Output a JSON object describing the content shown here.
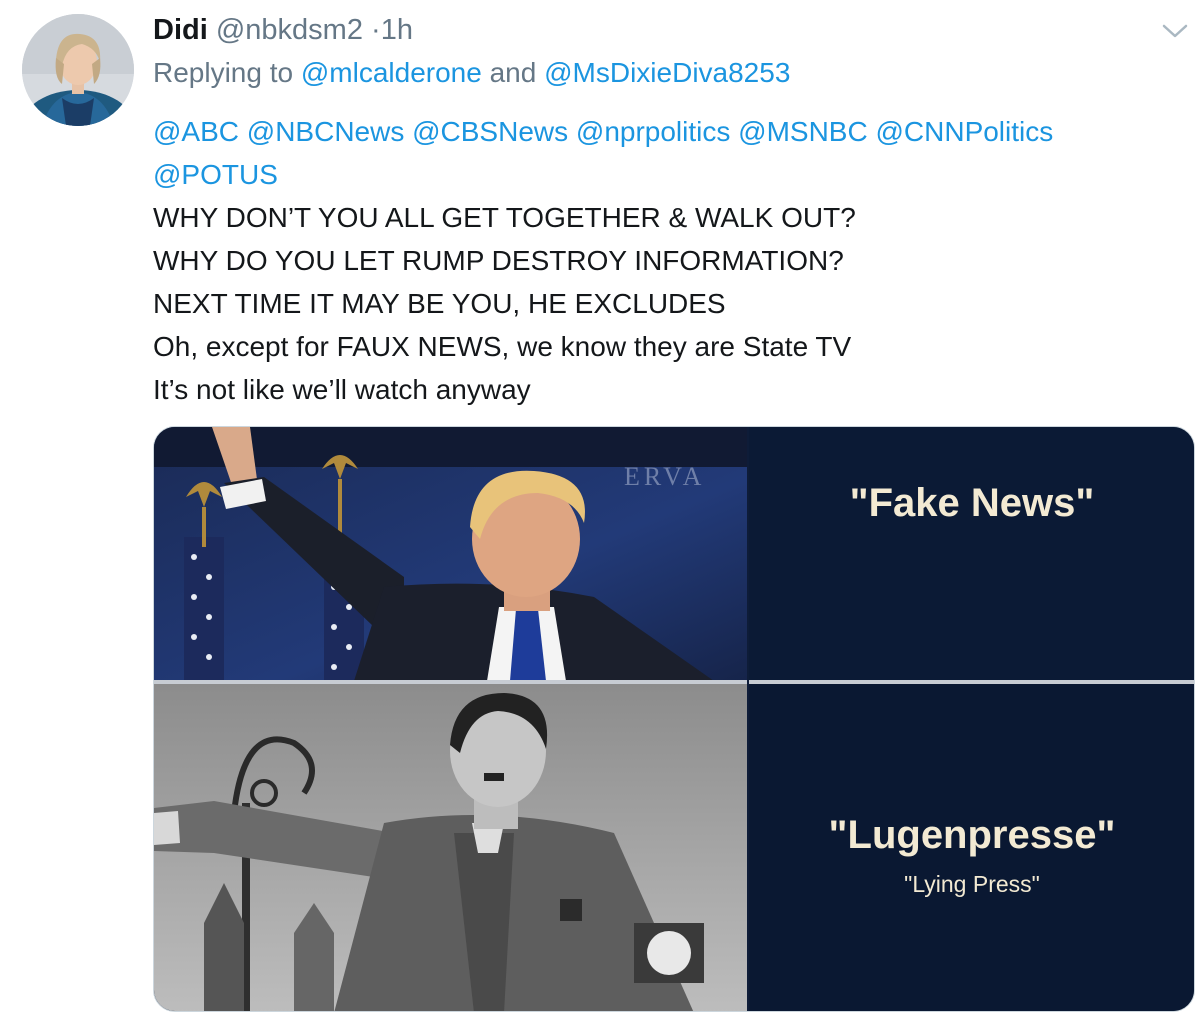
{
  "tweet": {
    "display_name": "Didi",
    "handle": "@nbkdsm2",
    "separator": "·",
    "time": "1h",
    "replying_prefix": "Replying to",
    "reply_user_1": "@mlcalderone",
    "reply_and": "and",
    "reply_user_2": "@MsDixieDiva8253",
    "mentions_line_1": "@ABC @NBCNews @CBSNews @nprpolitics @MSNBC @CNNPolitics",
    "mentions_line_2": "@POTUS",
    "lines": [
      "WHY DON’T YOU ALL GET TOGETHER & WALK OUT?",
      "WHY DO YOU LET RUMP DESTROY INFORMATION?",
      "NEXT TIME IT MAY BE YOU, HE EXCLUDES",
      "Oh, except for FAUX NEWS, we know they are State TV",
      "It’s not like we’ll watch anyway"
    ]
  },
  "media": {
    "top_caption": "\"Fake News\"",
    "bottom_caption": "\"Lugenpresse\"",
    "bottom_subcaption": "\"Lying Press\"",
    "backdrop_text": "ERVA"
  },
  "icons": {
    "avatar": "avatar-photo",
    "menu": "chevron-down-icon"
  },
  "colors": {
    "link": "#1b95e0",
    "muted": "#657786",
    "caption_bg": "#0b1a35",
    "caption_text": "#f3ead3"
  }
}
